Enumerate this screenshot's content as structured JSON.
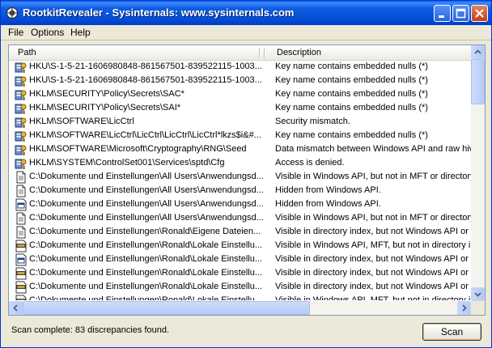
{
  "window": {
    "title": "RootkitRevealer - Sysinternals: www.sysinternals.com"
  },
  "menu": {
    "file": "File",
    "options": "Options",
    "help": "Help"
  },
  "list": {
    "columns": {
      "path": "Path",
      "description": "Description"
    },
    "rows": [
      {
        "icon": "registry-key-icon",
        "path": "HKU\\S-1-5-21-1606980848-861567501-839522115-1003...",
        "description": "Key name contains embedded nulls (*)"
      },
      {
        "icon": "registry-key-icon",
        "path": "HKU\\S-1-5-21-1606980848-861567501-839522115-1003...",
        "description": "Key name contains embedded nulls (*)"
      },
      {
        "icon": "registry-key-icon",
        "path": "HKLM\\SECURITY\\Policy\\Secrets\\SAC*",
        "description": "Key name contains embedded nulls (*)"
      },
      {
        "icon": "registry-key-icon",
        "path": "HKLM\\SECURITY\\Policy\\Secrets\\SAI*",
        "description": "Key name contains embedded nulls (*)"
      },
      {
        "icon": "registry-key-icon",
        "path": "HKLM\\SOFTWARE\\LicCtrl",
        "description": "Security mismatch."
      },
      {
        "icon": "registry-key-icon",
        "path": "HKLM\\SOFTWARE\\LicCtrl\\LicCtrl\\LicCtrl\\LicCtrl*lkzs$i&#...",
        "description": "Key name contains embedded nulls (*)"
      },
      {
        "icon": "registry-key-icon",
        "path": "HKLM\\SOFTWARE\\Microsoft\\Cryptography\\RNG\\Seed",
        "description": "Data mismatch between Windows API and raw hive"
      },
      {
        "icon": "registry-key-icon",
        "path": "HKLM\\SYSTEM\\ControlSet001\\Services\\sptd\\Cfg",
        "description": "Access is denied."
      },
      {
        "icon": "file-icon",
        "path": "C:\\Dokumente und Einstellungen\\All Users\\Anwendungsd...",
        "description": "Visible in Windows API, but not in MFT or directory"
      },
      {
        "icon": "file-icon",
        "path": "C:\\Dokumente und Einstellungen\\All Users\\Anwendungsd...",
        "description": "Hidden from Windows API."
      },
      {
        "icon": "window-file-icon",
        "path": "C:\\Dokumente und Einstellungen\\All Users\\Anwendungsd...",
        "description": "Hidden from Windows API."
      },
      {
        "icon": "file-icon",
        "path": "C:\\Dokumente und Einstellungen\\All Users\\Anwendungsd...",
        "description": "Visible in Windows API, but not in MFT or directory"
      },
      {
        "icon": "file-icon",
        "path": "C:\\Dokumente und Einstellungen\\Ronald\\Eigene Dateien...",
        "description": "Visible in directory index, but not Windows API or M"
      },
      {
        "icon": "tmp-file-icon",
        "path": "C:\\Dokumente und Einstellungen\\Ronald\\Lokale Einstellu...",
        "description": "Visible in Windows API, MFT, but not in directory in"
      },
      {
        "icon": "window-file-icon",
        "path": "C:\\Dokumente und Einstellungen\\Ronald\\Lokale Einstellu...",
        "description": "Visible in directory index, but not Windows API or M"
      },
      {
        "icon": "tmp-file-icon",
        "path": "C:\\Dokumente und Einstellungen\\Ronald\\Lokale Einstellu...",
        "description": "Visible in directory index, but not Windows API or M"
      },
      {
        "icon": "tmp-file-icon",
        "path": "C:\\Dokumente und Einstellungen\\Ronald\\Lokale Einstellu...",
        "description": "Visible in directory index, but not Windows API or M"
      },
      {
        "icon": "tmp-file-icon",
        "path": "C:\\Dokumente und Einstellungen\\Ronald\\Lokale Einstellu...",
        "description": "Visible in Windows API, MFT, but not in directory in"
      }
    ]
  },
  "status": {
    "text": "Scan complete: 83 discrepancies found."
  },
  "scan_button": {
    "label": "Scan"
  }
}
